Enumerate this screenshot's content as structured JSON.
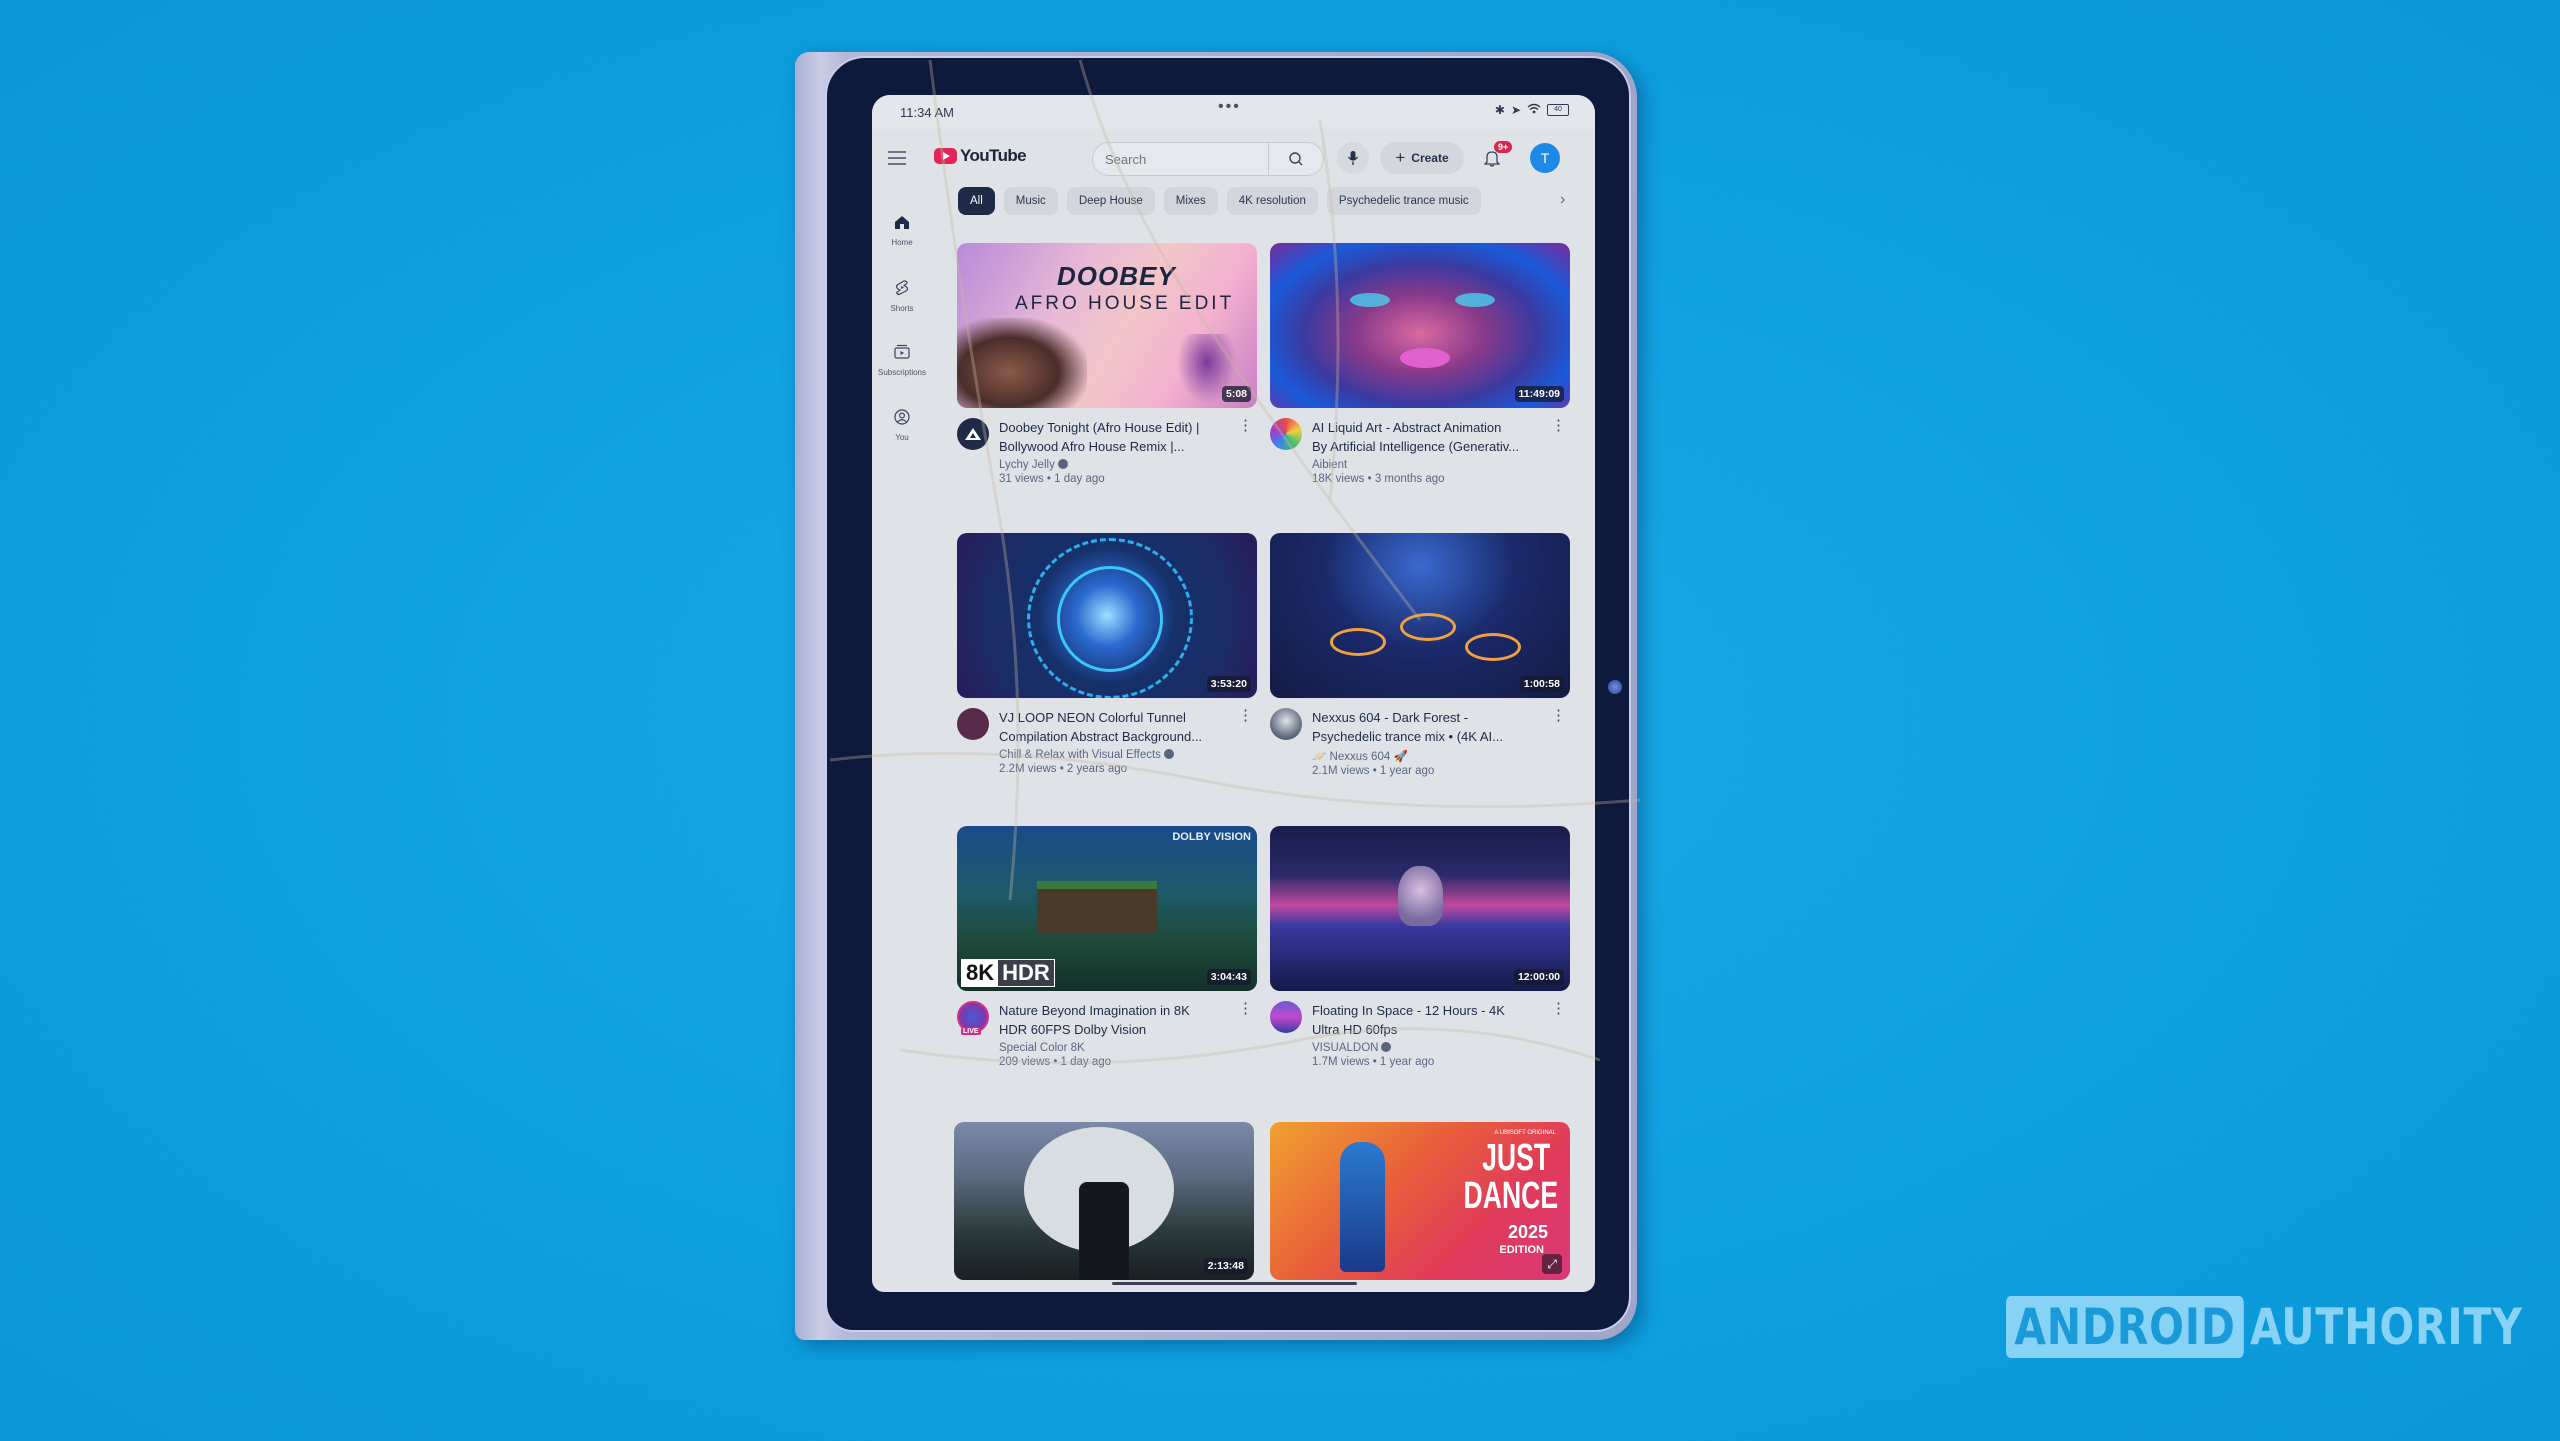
{
  "status_bar": {
    "time": "11:34 AM",
    "battery": "40",
    "icons": [
      "bluetooth-icon",
      "location-icon",
      "wifi-icon",
      "battery-icon"
    ]
  },
  "header": {
    "logo_text": "YouTube",
    "search_placeholder": "Search",
    "create_label": "Create",
    "notification_badge": "9+",
    "avatar_initial": "T"
  },
  "chips": [
    {
      "label": "All",
      "active": true
    },
    {
      "label": "Music"
    },
    {
      "label": "Deep House"
    },
    {
      "label": "Mixes"
    },
    {
      "label": "4K resolution"
    },
    {
      "label": "Psychedelic trance music"
    }
  ],
  "sidebar": {
    "items": [
      {
        "label": "Home",
        "icon": "home-icon"
      },
      {
        "label": "Shorts",
        "icon": "shorts-icon"
      },
      {
        "label": "Subscriptions",
        "icon": "subscriptions-icon"
      },
      {
        "label": "You",
        "icon": "user-icon"
      }
    ]
  },
  "videos": [
    {
      "title_line1": "Doobey Tonight (Afro House Edit) |",
      "title_line2": "Bollywood Afro House Remix |...",
      "channel": "Lychy Jelly",
      "verified": true,
      "stats": "31 views • 1 day ago",
      "duration": "5:08",
      "thumb_text1": "DOOBEY",
      "thumb_text2": "AFRO HOUSE EDIT"
    },
    {
      "title_line1": "AI Liquid Art - Abstract Animation",
      "title_line2": "By Artificial Intelligence (Generativ...",
      "channel": "Aibient",
      "verified": false,
      "stats": "18K views • 3 months ago",
      "duration": "11:49:09"
    },
    {
      "title_line1": "VJ LOOP NEON Colorful Tunnel",
      "title_line2": "Compilation Abstract Background...",
      "channel": "Chill & Relax with Visual Effects",
      "verified": true,
      "stats": "2.2M views • 2 years ago",
      "duration": "3:53:20"
    },
    {
      "title_line1": "Nexxus 604 - Dark Forest -",
      "title_line2": "Psychedelic trance mix • (4K AI...",
      "channel": "🪐 Nexxus 604 🚀",
      "verified": false,
      "stats": "2.1M views • 1 year ago",
      "duration": "1:00:58"
    },
    {
      "title_line1": "Nature Beyond Imagination in 8K",
      "title_line2": "HDR 60FPS Dolby Vision",
      "channel": "Special Color 8K",
      "verified": false,
      "stats": "209 views • 1 day ago",
      "duration": "3:04:43",
      "badge_8k": "8K",
      "badge_hdr": "HDR",
      "dolby": "DOLBY VISION",
      "live": "LIVE"
    },
    {
      "title_line1": "Floating In Space - 12 Hours - 4K",
      "title_line2": "Ultra HD 60fps",
      "channel": "VISUALDON",
      "verified": true,
      "stats": "1.7M views • 1 year ago",
      "duration": "12:00:00"
    },
    {
      "duration": "2:13:48"
    },
    {
      "thumb_small": "A UBISOFT ORIGINAL",
      "thumb_text1": "JUST",
      "thumb_text2": "DANCE",
      "thumb_text3": "2025",
      "thumb_text4": "EDITION"
    }
  ],
  "watermark": {
    "part1": "ANDROID",
    "part2": "AUTHORITY"
  }
}
